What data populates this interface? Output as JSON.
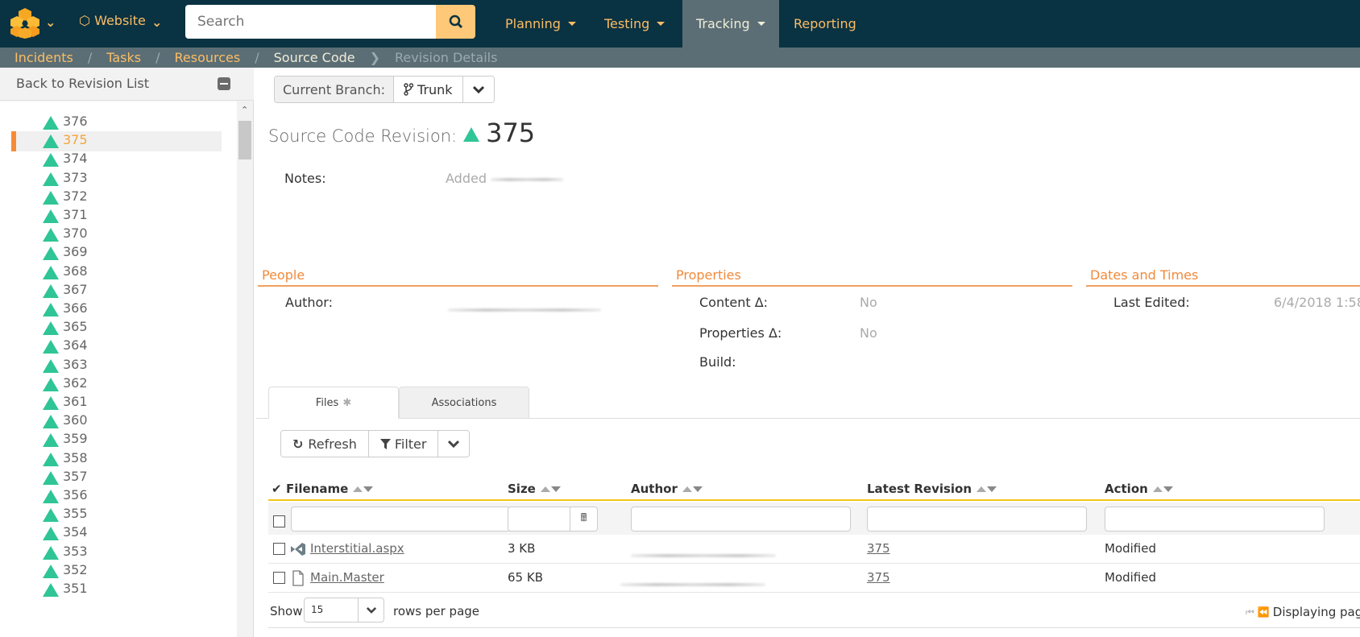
{
  "topbar": {
    "project_name": "Website",
    "search_placeholder": "Search",
    "nav": [
      {
        "label": "Planning",
        "has_dropdown": true,
        "active": false
      },
      {
        "label": "Testing",
        "has_dropdown": true,
        "active": false
      },
      {
        "label": "Tracking",
        "has_dropdown": true,
        "active": true
      },
      {
        "label": "Reporting",
        "has_dropdown": false,
        "active": false
      }
    ]
  },
  "breadcrumb": {
    "items": [
      "Incidents",
      "Tasks",
      "Resources"
    ],
    "current": "Source Code",
    "last": "Revision Details"
  },
  "sidebar": {
    "back_label": "Back to Revision List",
    "selected": "375",
    "revisions": [
      "376",
      "375",
      "374",
      "373",
      "372",
      "371",
      "370",
      "369",
      "368",
      "367",
      "366",
      "365",
      "364",
      "363",
      "362",
      "361",
      "360",
      "359",
      "358",
      "357",
      "356",
      "355",
      "354",
      "353",
      "352",
      "351"
    ]
  },
  "branch": {
    "label": "Current Branch:",
    "value": "Trunk"
  },
  "revision": {
    "title_label": "Source Code Revision:",
    "number": "375",
    "notes_label": "Notes:",
    "notes_value": "Added"
  },
  "sections": {
    "people": {
      "title": "People",
      "author_label": "Author:"
    },
    "properties": {
      "title": "Properties",
      "content_delta_label": "Content Δ:",
      "content_delta_value": "No",
      "properties_delta_label": "Properties Δ:",
      "properties_delta_value": "No",
      "build_label": "Build:"
    },
    "dates": {
      "title": "Dates and Times",
      "last_edited_label": "Last Edited:",
      "last_edited_value": "6/4/2018 1:58:"
    }
  },
  "tabs": [
    {
      "label": "Files",
      "active": true
    },
    {
      "label": "Associations",
      "active": false
    }
  ],
  "toolbar": {
    "refresh_label": "Refresh",
    "filter_label": "Filter"
  },
  "grid": {
    "columns": [
      "Filename",
      "Size",
      "Author",
      "Latest Revision",
      "Action"
    ],
    "rows": [
      {
        "filename": "Interstitial.aspx",
        "icon": "visual-studio-icon",
        "size": "3 KB",
        "latest_revision": "375",
        "action": "Modified"
      },
      {
        "filename": "Main.Master",
        "icon": "file-icon",
        "size": "65 KB",
        "latest_revision": "375",
        "action": "Modified"
      }
    ]
  },
  "pager": {
    "show_label": "Show",
    "rows_value": "15",
    "rows_label": "rows per page",
    "displaying_label": "Displaying pag"
  },
  "colors": {
    "topbar": "#093242",
    "accent": "#fbbd66",
    "breadcrumb_bar": "#5b6e75",
    "section_title": "#f08a3c",
    "revision_triangle": "#2fc596",
    "selected_marker": "#f68b37"
  }
}
